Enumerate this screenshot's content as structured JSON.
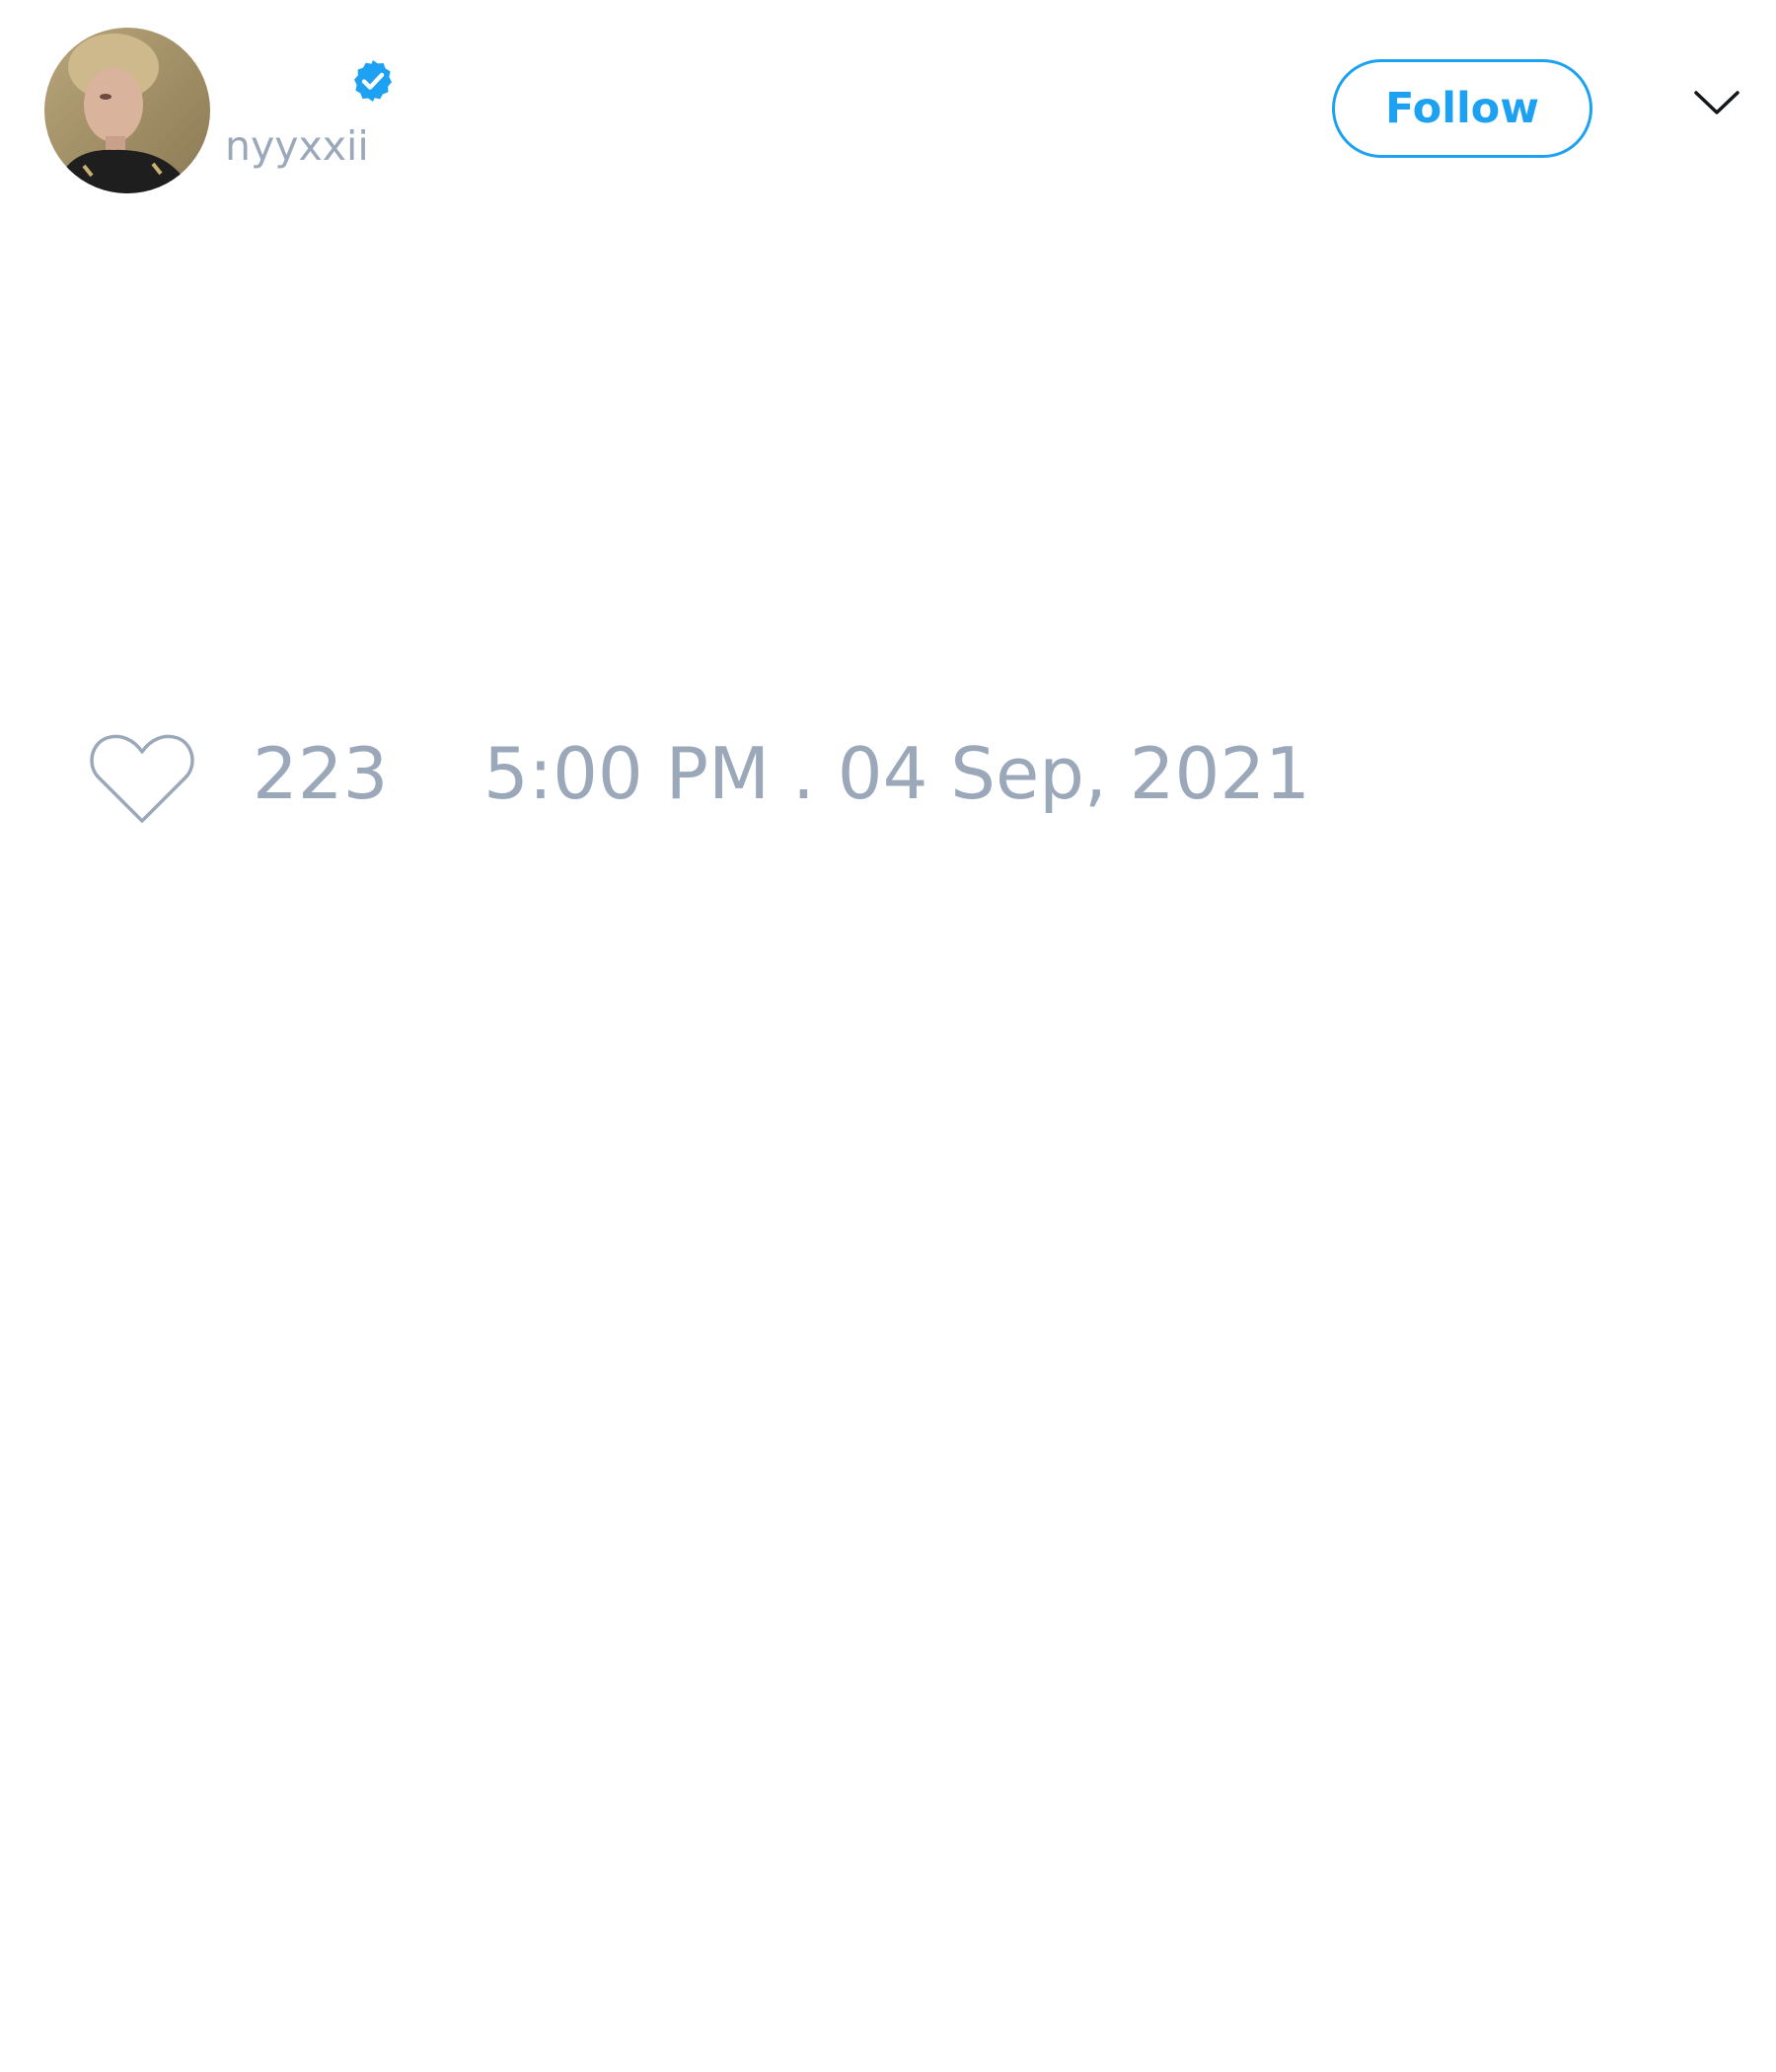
{
  "tweet": {
    "author": {
      "display_name": "",
      "handle": "nyyxxii",
      "verified": true,
      "avatar_icon": "profile-photo"
    },
    "follow_label": "Follow",
    "menu_icon": "chevron-down-icon",
    "like_icon": "heart-outline-icon",
    "like_count": "223",
    "timestamp": "5:00 PM . 04 Sep, 2021"
  },
  "colors": {
    "accent": "#1da1f2",
    "muted_text": "#9aa8ba",
    "background": "#ffffff"
  }
}
